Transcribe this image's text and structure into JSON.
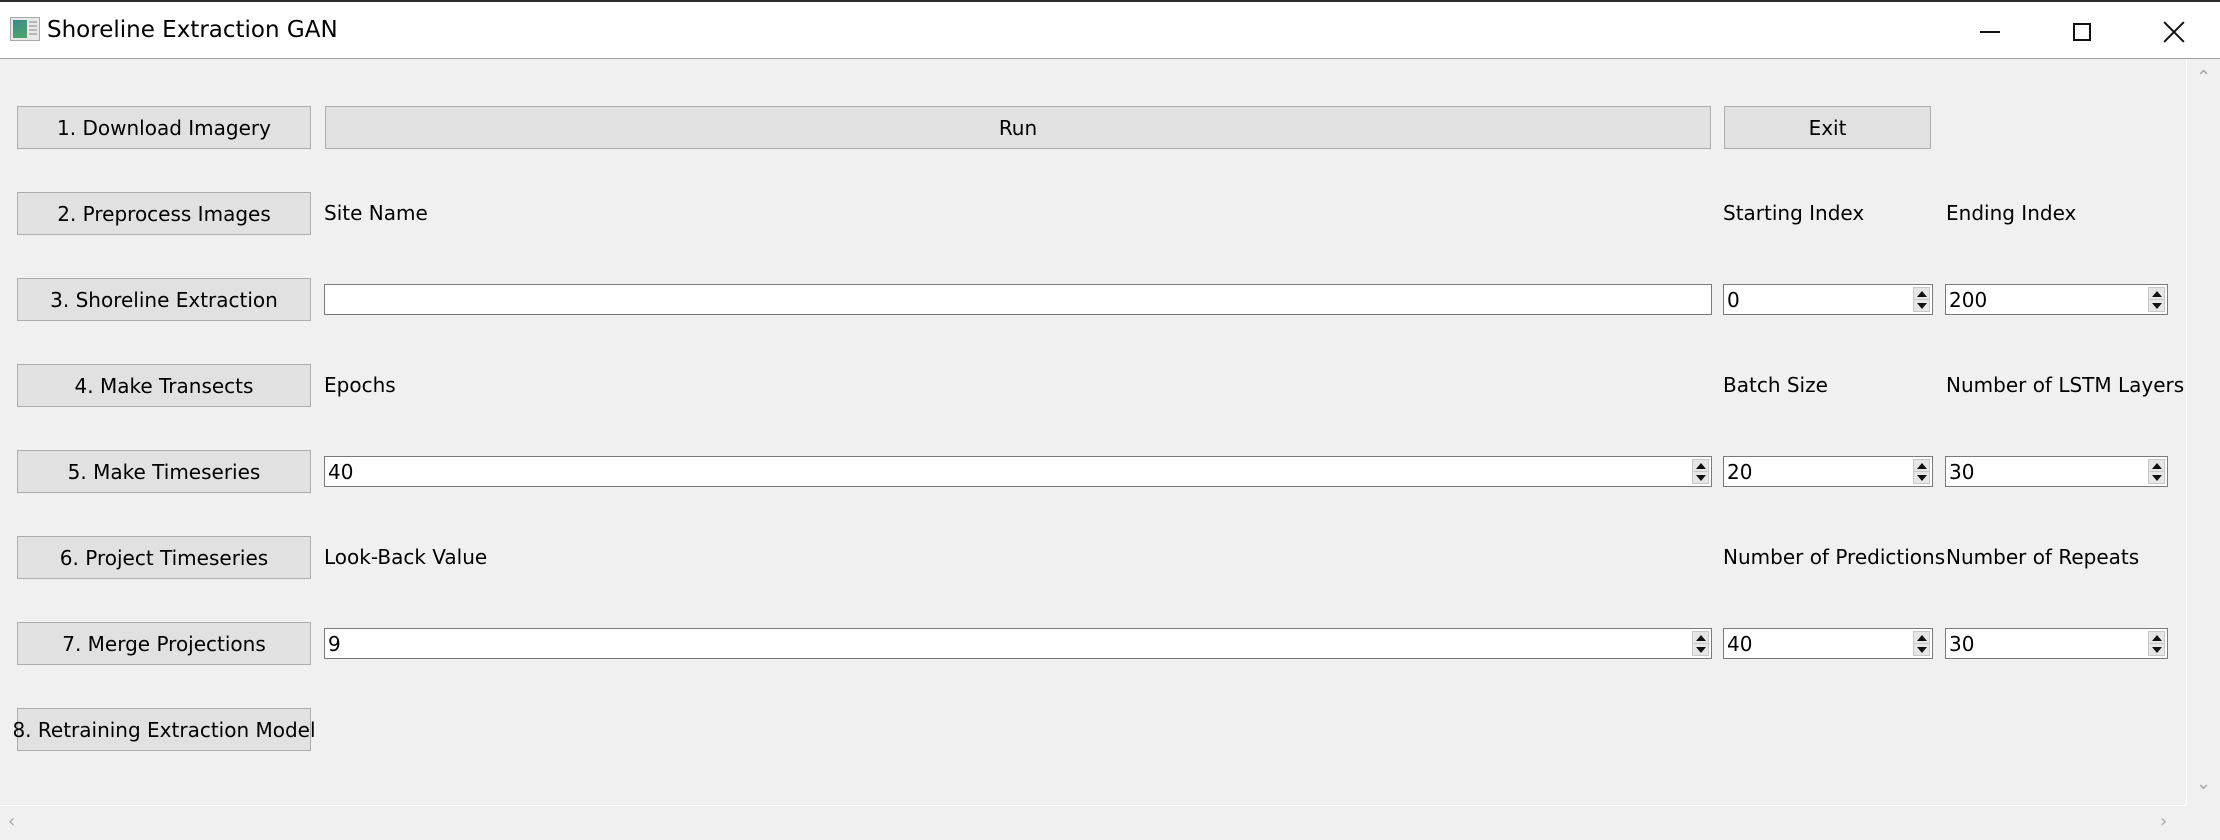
{
  "window": {
    "title": "Shoreline Extraction GAN",
    "icon": "app-window-icon",
    "controls": {
      "minimize": "minimize-icon",
      "maximize": "maximize-icon",
      "close": "close-icon"
    }
  },
  "steps": [
    {
      "label": "1. Download Imagery"
    },
    {
      "label": "2. Preprocess Images"
    },
    {
      "label": "3. Shoreline Extraction"
    },
    {
      "label": "4. Make Transects"
    },
    {
      "label": "5. Make Timeseries"
    },
    {
      "label": "6. Project Timeseries"
    },
    {
      "label": "7. Merge Projections"
    },
    {
      "label": "8. Retraining Extraction Model"
    }
  ],
  "actions": {
    "run": "Run",
    "exit": "Exit"
  },
  "labels": {
    "site_name": "Site Name",
    "starting_index": "Starting Index",
    "ending_index": "Ending Index",
    "epochs": "Epochs",
    "batch_size": "Batch Size",
    "lstm_layers": "Number of LSTM Layers",
    "look_back": "Look-Back Value",
    "num_predictions": "Number of Predictions",
    "num_repeats": "Number of Repeats"
  },
  "values": {
    "site_name": "",
    "starting_index": "0",
    "ending_index": "200",
    "epochs": "40",
    "batch_size": "20",
    "lstm_layers": "30",
    "look_back": "9",
    "num_predictions": "40",
    "num_repeats": "30"
  },
  "scrollbars": {
    "up": "chevron-up-icon",
    "down": "chevron-down-icon",
    "left": "chevron-left-icon",
    "right": "chevron-right-icon"
  }
}
